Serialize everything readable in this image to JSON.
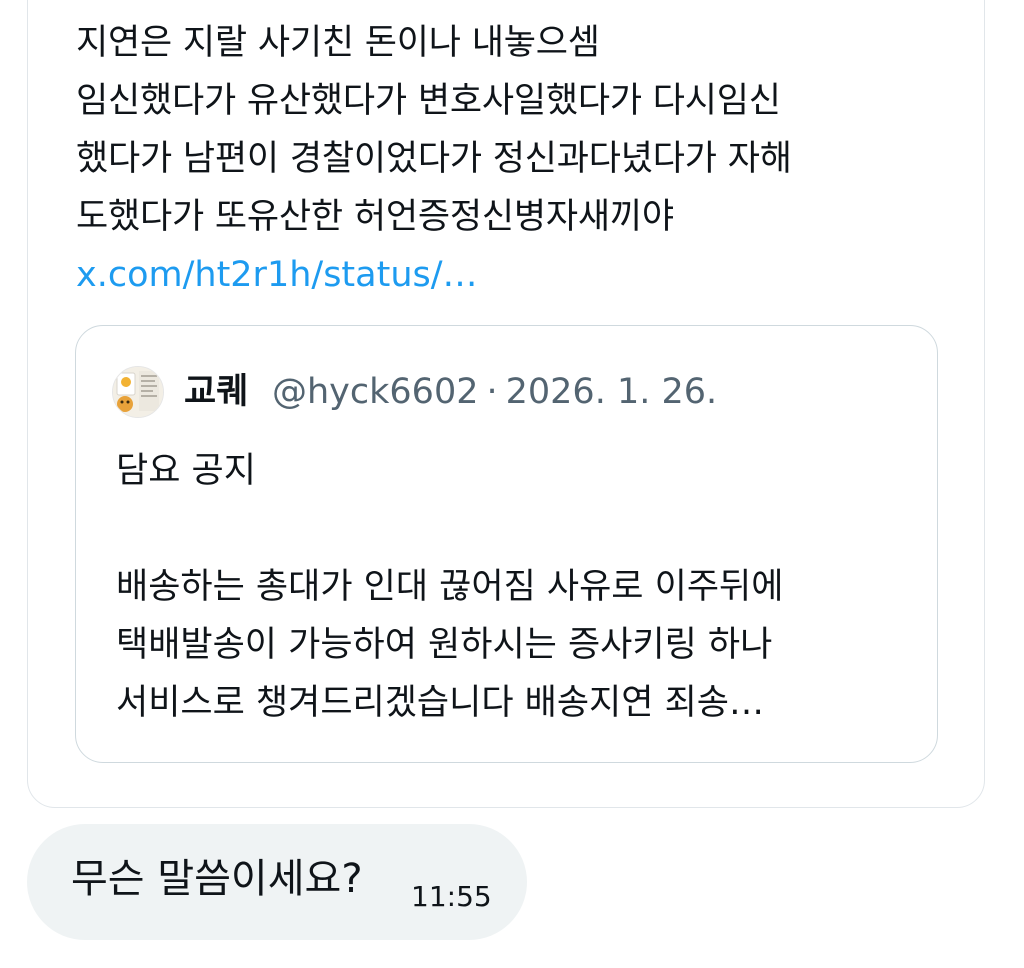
{
  "shared_post": {
    "text_lines": [
      "지연은 지랄 사기친 돈이나 내놓으셈",
      "임신했다가 유산했다가 변호사일했다가 다시임신",
      "했다가 남편이 경찰이었다가 정신과다녔다가 자해",
      "도했다가 또유산한 허언증정신병자새끼야"
    ],
    "link": "x.com/ht2r1h/status/…"
  },
  "quoted_post": {
    "display_name": "교퀘",
    "handle": "@hyck6602",
    "separator": "·",
    "date": "2026. 1. 26.",
    "body_lines": [
      "담요 공지",
      "",
      "배송하는 총대가 인대 끊어짐 사유로 이주뒤에",
      "택배발송이 가능하여 원하시는 증사키링 하나",
      "서비스로 챙겨드리겠습니다 배송지연 죄송…"
    ]
  },
  "reply": {
    "text": "무슨 말씀이세요?",
    "time": "11:55"
  },
  "colors": {
    "text": "#0f1419",
    "link": "#1d9bf0",
    "muted": "#536471",
    "bubble": "#eff3f4",
    "border": "#cfd9de"
  }
}
